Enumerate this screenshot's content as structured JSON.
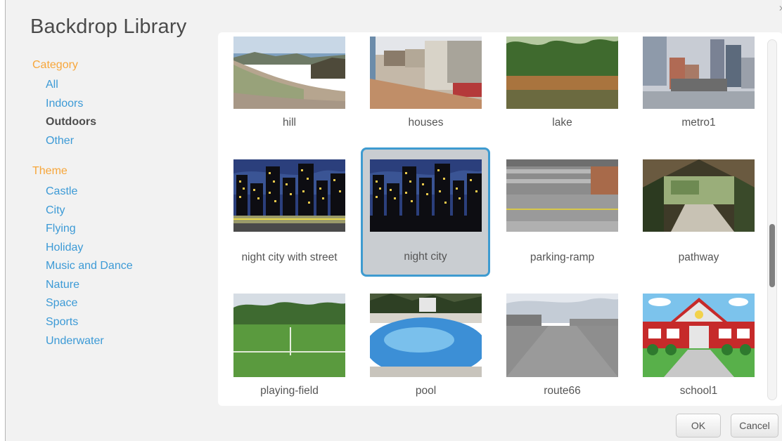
{
  "dialog": {
    "title": "Backdrop Library",
    "close_glyph": "×"
  },
  "sidebar": {
    "category_label": "Category",
    "categories": [
      {
        "label": "All",
        "selected": false
      },
      {
        "label": "Indoors",
        "selected": false
      },
      {
        "label": "Outdoors",
        "selected": true
      },
      {
        "label": "Other",
        "selected": false
      }
    ],
    "theme_label": "Theme",
    "themes": [
      {
        "label": "Castle"
      },
      {
        "label": "City"
      },
      {
        "label": "Flying"
      },
      {
        "label": "Holiday"
      },
      {
        "label": "Music and Dance"
      },
      {
        "label": "Nature"
      },
      {
        "label": "Space"
      },
      {
        "label": "Sports"
      },
      {
        "label": "Underwater"
      }
    ]
  },
  "library": {
    "items": [
      {
        "label": "hill",
        "thumbnail": "hill-photo"
      },
      {
        "label": "houses",
        "thumbnail": "houses-photo"
      },
      {
        "label": "lake",
        "thumbnail": "lake-photo"
      },
      {
        "label": "metro1",
        "thumbnail": "metro-photo"
      },
      {
        "label": "night city with street",
        "thumbnail": "night-city-street-drawing"
      },
      {
        "label": "night city",
        "thumbnail": "night-city-drawing",
        "selected": true
      },
      {
        "label": "parking-ramp",
        "thumbnail": "parking-ramp-photo"
      },
      {
        "label": "pathway",
        "thumbnail": "pathway-photo"
      },
      {
        "label": "playing-field",
        "thumbnail": "playing-field-photo"
      },
      {
        "label": "pool",
        "thumbnail": "pool-photo"
      },
      {
        "label": "route66",
        "thumbnail": "route66-photo"
      },
      {
        "label": "school1",
        "thumbnail": "school-drawing"
      }
    ]
  },
  "buttons": {
    "ok": "OK",
    "cancel": "Cancel"
  },
  "colors": {
    "accent_orange": "#f7a63a",
    "link_blue": "#3c9ad6",
    "selection_border": "#3e9bd0"
  }
}
